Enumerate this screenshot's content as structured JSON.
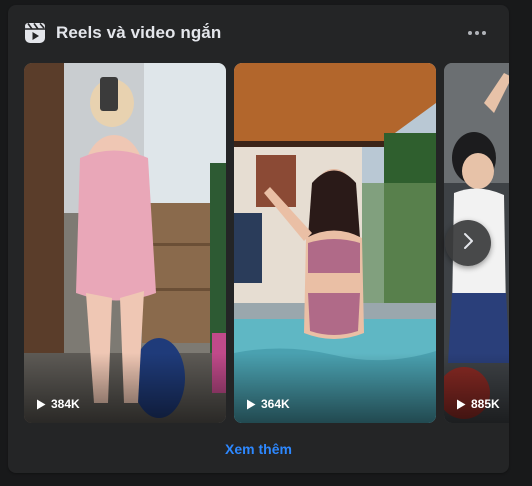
{
  "section": {
    "title": "Reels và video ngắn",
    "icon": "reels-icon",
    "more_icon": "more-horizontal-icon"
  },
  "reels": [
    {
      "views": "384K"
    },
    {
      "views": "364K"
    },
    {
      "views": "885K"
    }
  ],
  "navigation": {
    "next_icon": "chevron-right-icon"
  },
  "footer": {
    "see_more_label": "Xem thêm"
  },
  "colors": {
    "background": "#18191a",
    "card": "#242526",
    "text_primary": "#e4e6eb",
    "link": "#2d88ff"
  }
}
